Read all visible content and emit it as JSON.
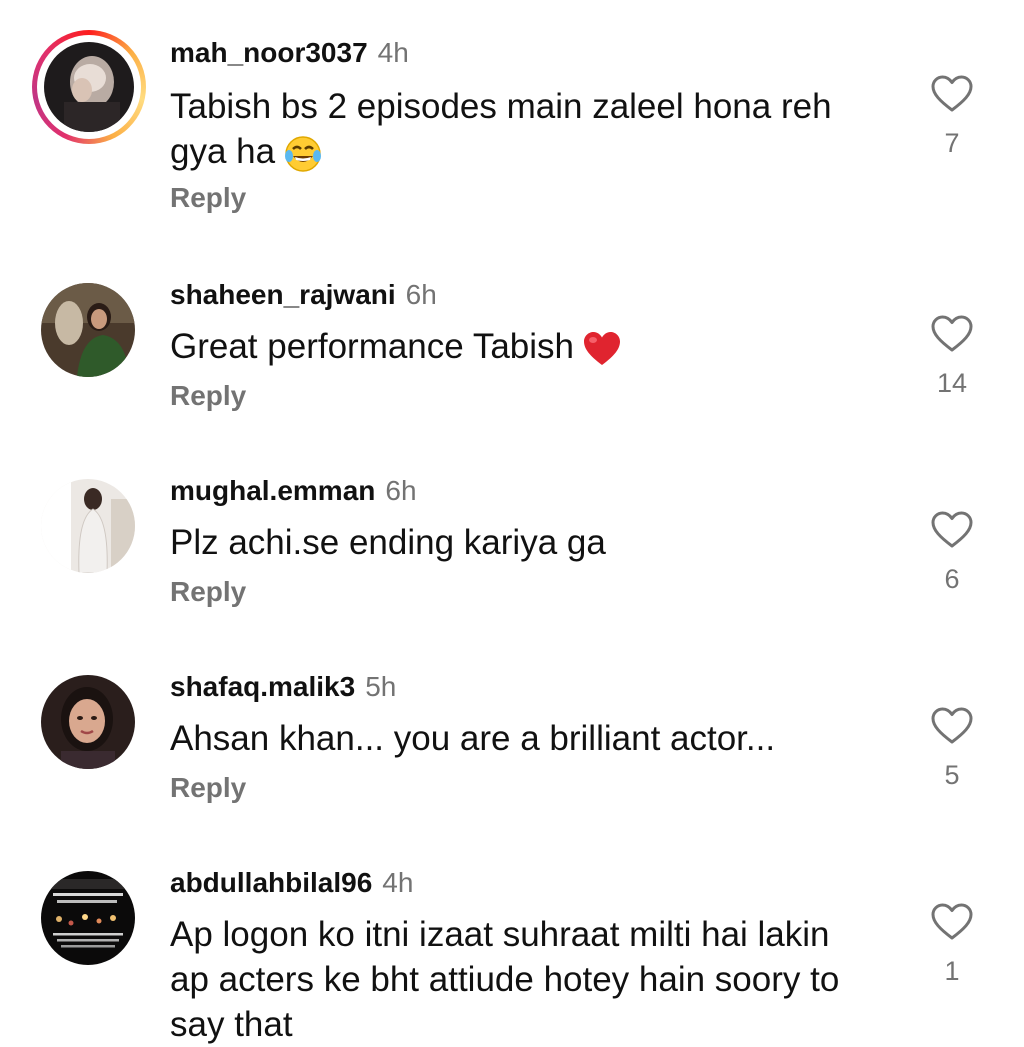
{
  "comments": [
    {
      "username": "mah_noor3037",
      "time": "4h",
      "text": "Tabish bs 2 episodes main zaleel hona reh gya ha",
      "emoji": "tears-of-joy-emoji",
      "reply_label": "Reply",
      "likes": "7",
      "has_story": true
    },
    {
      "username": "shaheen_rajwani",
      "time": "6h",
      "text": "Great performance Tabish",
      "emoji": "red-heart-emoji",
      "reply_label": "Reply",
      "likes": "14",
      "has_story": false
    },
    {
      "username": "mughal.emman",
      "time": "6h",
      "text": "Plz achi.se ending kariya ga",
      "reply_label": "Reply",
      "likes": "6",
      "has_story": false
    },
    {
      "username": "shafaq.malik3",
      "time": "5h",
      "text": "Ahsan khan... you are a brilliant actor...",
      "reply_label": "Reply",
      "likes": "5",
      "has_story": false
    },
    {
      "username": "abdullahbilal96",
      "time": "4h",
      "text": "Ap logon ko itni izaat suhraat milti hai lakin ap acters ke bht attiude hotey hain soory to say that",
      "likes": "1",
      "has_story": false
    }
  ],
  "icons": {
    "like": "heart-outline-icon"
  },
  "colors": {
    "secondary_text": "#737373",
    "primary_text": "#111111",
    "story_ring": "#e1306c"
  }
}
